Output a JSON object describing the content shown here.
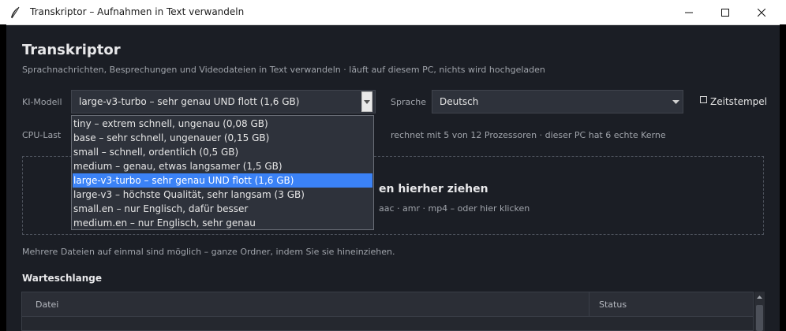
{
  "window": {
    "title": "Transkriptor  –  Aufnahmen in Text verwandeln",
    "controls": [
      "minimize",
      "maximize",
      "close"
    ]
  },
  "header": {
    "title": "Transkriptor",
    "subtitle": "Sprachnachrichten, Besprechungen und Videodateien in Text verwandeln  ·  läuft auf diesem PC, nichts wird hochgeladen"
  },
  "settings": {
    "model_label": "KI-Modell",
    "model_value": "large-v3-turbo  –  sehr genau UND flott  (1,6 GB)",
    "language_label": "Sprache",
    "language_value": "Deutsch",
    "timestamps_label": "Zeitstempel",
    "timestamps_checked": false,
    "cpu_label": "CPU-Last",
    "cpu_info": "rechnet mit 5 von 12 Prozessoren  ·  dieser PC hat 6 echte Kerne"
  },
  "model_options": [
    "tiny  –  extrem schnell, ungenau  (0,08 GB)",
    "base  –  sehr schnell, ungenauer  (0,15 GB)",
    "small  –  schnell, ordentlich  (0,5 GB)",
    "medium  –  genau, etwas langsamer  (1,5 GB)",
    "large-v3-turbo  –  sehr genau UND flott  (1,6 GB)",
    "large-v3  –  höchste Qualität, sehr langsam  (3 GB)",
    "small.en  –  nur Englisch, dafür besser",
    "medium.en  –  nur Englisch, sehr genau"
  ],
  "selected_model_index": 4,
  "dropzone": {
    "title_visible": "en hierher ziehen",
    "formats_visible": "aac  ·  amr  ·  mp4     –  oder hier klicken"
  },
  "hint": "Mehrere Dateien auf einmal sind möglich – ganze Ordner, indem Sie sie hineinziehen.",
  "queue": {
    "title": "Warteschlange",
    "columns": [
      "Datei",
      "Status"
    ],
    "rows": []
  },
  "colors": {
    "background": "#1b1e25",
    "field": "#2e323b",
    "selection": "#3b82f6",
    "text": "#e6e6e6",
    "muted_text": "#a0a4ab"
  }
}
